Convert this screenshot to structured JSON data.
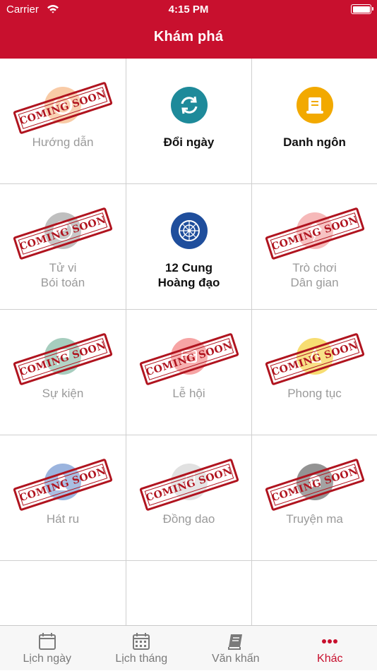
{
  "status_bar": {
    "carrier": "Carrier",
    "time": "4:15 PM"
  },
  "header": {
    "title": "Khám phá"
  },
  "stamp_text": "COMING SOON",
  "colors": {
    "brand": "#c8102e",
    "stamp": "#b0141f"
  },
  "grid_items": [
    {
      "line1": "Hướng dẫn",
      "line2": "",
      "icon": "help-icon",
      "color": "#f4a15f",
      "coming_soon": true
    },
    {
      "line1": "Đổi ngày",
      "line2": "",
      "icon": "refresh-icon",
      "color": "#1e8a9a",
      "coming_soon": false
    },
    {
      "line1": "Danh ngôn",
      "line2": "",
      "icon": "scroll-icon",
      "color": "#f2a900",
      "coming_soon": false
    },
    {
      "line1": "Tử vi",
      "line2": "Bói toán",
      "icon": "yin-yang-icon",
      "color": "#8c8c8c",
      "coming_soon": true
    },
    {
      "line1": "12 Cung",
      "line2": "Hoàng đạo",
      "icon": "zodiac-wheel-icon",
      "color": "#1f4e9c",
      "coming_soon": false
    },
    {
      "line1": "Trò chơi",
      "line2": "Dân gian",
      "icon": "kite-icon",
      "color": "#f08080",
      "coming_soon": true
    },
    {
      "line1": "Sự kiện",
      "line2": "",
      "icon": "flag-icon",
      "color": "#5fa68a",
      "coming_soon": true
    },
    {
      "line1": "Lễ hội",
      "line2": "",
      "icon": "festival-icon",
      "color": "#f05a5a",
      "coming_soon": true
    },
    {
      "line1": "Phong tục",
      "line2": "",
      "icon": "custom-icon",
      "color": "#f2c200",
      "coming_soon": true
    },
    {
      "line1": "Hát ru",
      "line2": "",
      "icon": "lullaby-icon",
      "color": "#4a78c4",
      "coming_soon": true
    },
    {
      "line1": "Đồng dao",
      "line2": "",
      "icon": "music-note-icon",
      "color": "#c9c9c9",
      "coming_soon": true
    },
    {
      "line1": "Truyện ma",
      "line2": "",
      "icon": "ghost-icon",
      "color": "#3c3c3c",
      "coming_soon": true
    }
  ],
  "tabs": [
    {
      "label": "Lịch ngày",
      "icon": "calendar-day-icon",
      "active": false
    },
    {
      "label": "Lịch tháng",
      "icon": "calendar-month-icon",
      "active": false
    },
    {
      "label": "Văn khấn",
      "icon": "book-icon",
      "active": false
    },
    {
      "label": "Khác",
      "icon": "more-dots-icon",
      "active": true
    }
  ]
}
